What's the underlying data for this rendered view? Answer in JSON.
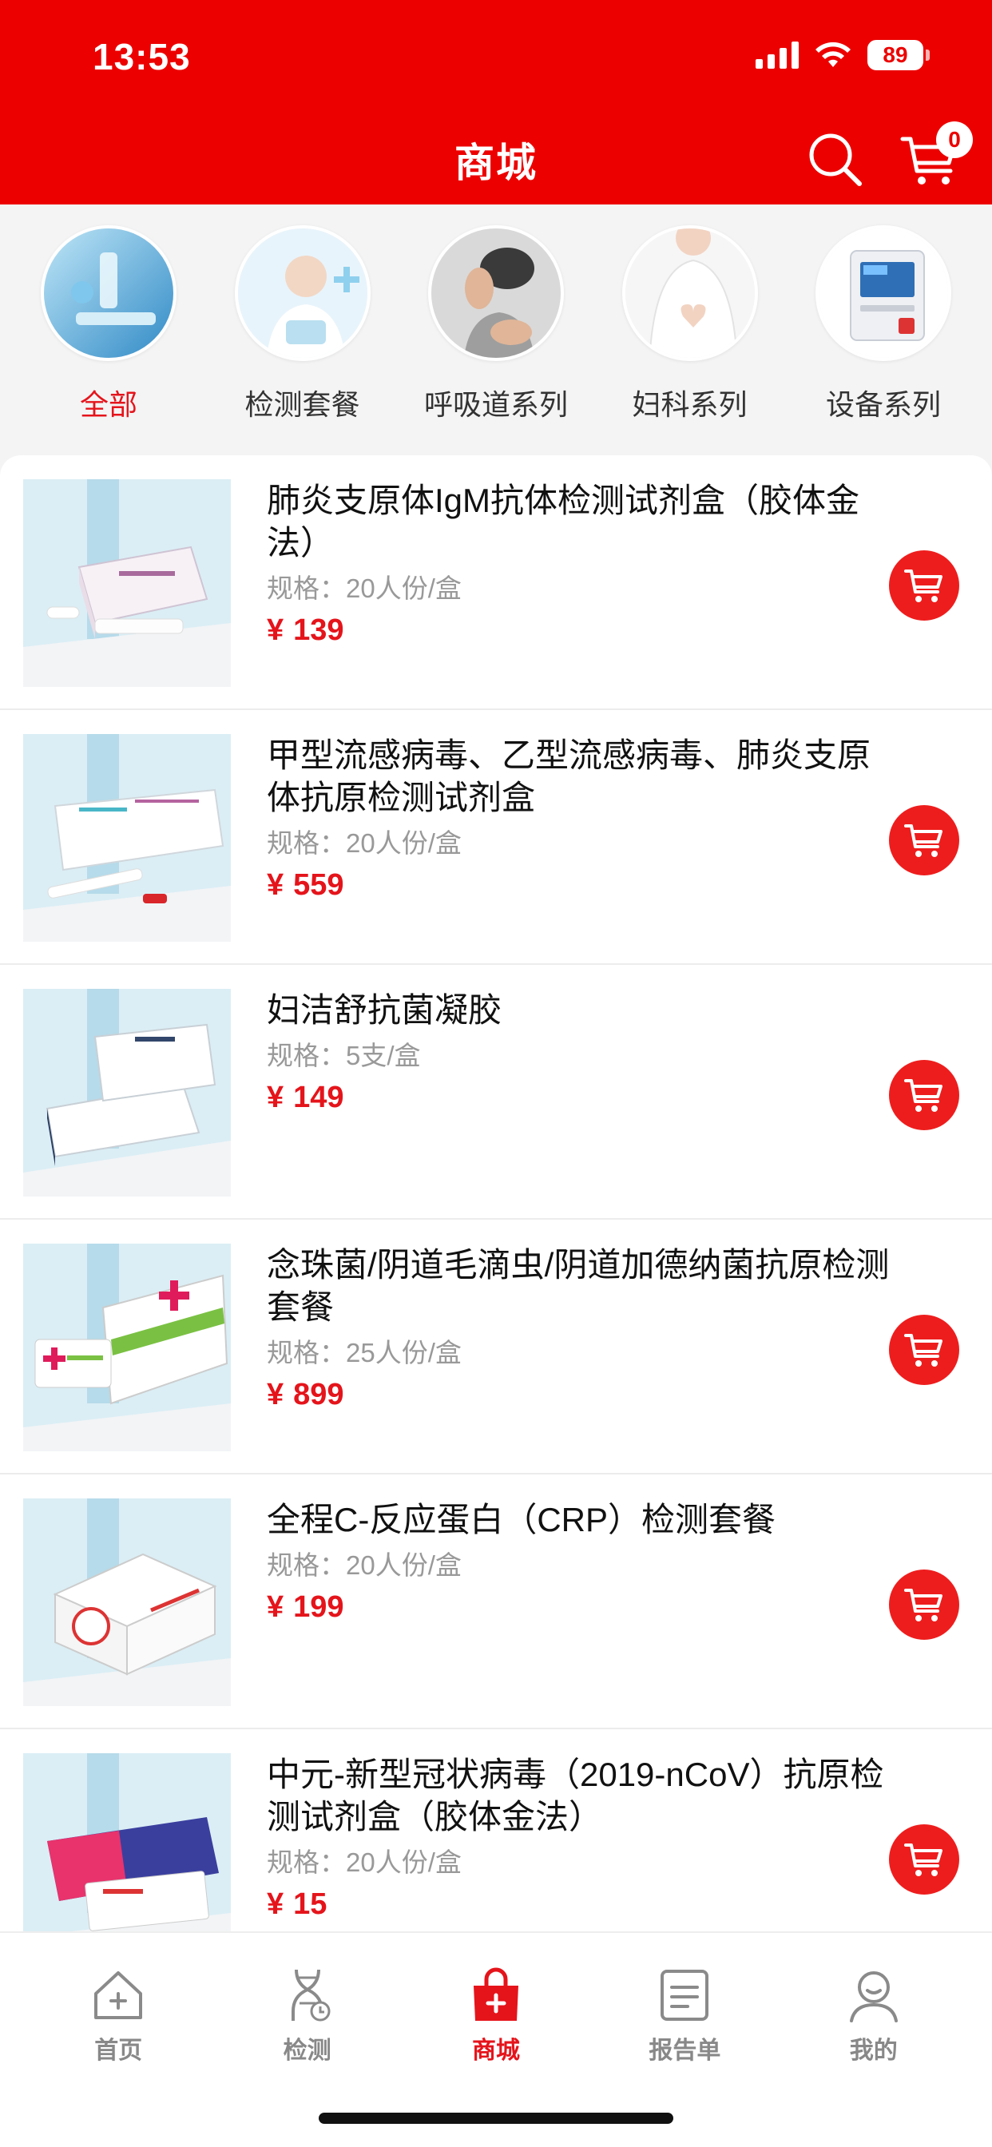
{
  "status_bar": {
    "time": "13:53",
    "battery": "89"
  },
  "header": {
    "title": "商城",
    "cart_count": "0"
  },
  "categories": [
    {
      "label": "全部",
      "active": true
    },
    {
      "label": "检测套餐",
      "active": false
    },
    {
      "label": "呼吸道系列",
      "active": false
    },
    {
      "label": "妇科系列",
      "active": false
    },
    {
      "label": "设备系列",
      "active": false
    }
  ],
  "products": [
    {
      "name": "肺炎支原体IgM抗体检测试剂盒（胶体金法）",
      "spec": "规格：20人份/盒",
      "currency": "¥",
      "price": "139"
    },
    {
      "name": "甲型流感病毒、乙型流感病毒、肺炎支原体抗原检测试剂盒",
      "spec": "规格：20人份/盒",
      "currency": "¥",
      "price": "559"
    },
    {
      "name": "妇洁舒抗菌凝胶",
      "spec": "规格：5支/盒",
      "currency": "¥",
      "price": "149"
    },
    {
      "name": "念珠菌/阴道毛滴虫/阴道加德纳菌抗原检测套餐",
      "spec": "规格：25人份/盒",
      "currency": "¥",
      "price": "899"
    },
    {
      "name": "全程C-反应蛋白（CRP）检测套餐",
      "spec": "规格：20人份/盒",
      "currency": "¥",
      "price": "199"
    },
    {
      "name": "中元-新型冠状病毒（2019-nCoV）抗原检测试剂盒（胶体金法）",
      "spec": "规格：20人份/盒",
      "currency": "¥",
      "price": "15"
    }
  ],
  "tabbar": [
    {
      "label": "首页",
      "icon": "home-icon",
      "active": false
    },
    {
      "label": "检测",
      "icon": "dna-icon",
      "active": false
    },
    {
      "label": "商城",
      "icon": "shopping-bag-icon",
      "active": true
    },
    {
      "label": "报告单",
      "icon": "report-icon",
      "active": false
    },
    {
      "label": "我的",
      "icon": "profile-icon",
      "active": false
    }
  ],
  "colors": {
    "brand": "#ec0000",
    "accent_text": "#e5141b",
    "cart_button": "#ee1d1d"
  }
}
